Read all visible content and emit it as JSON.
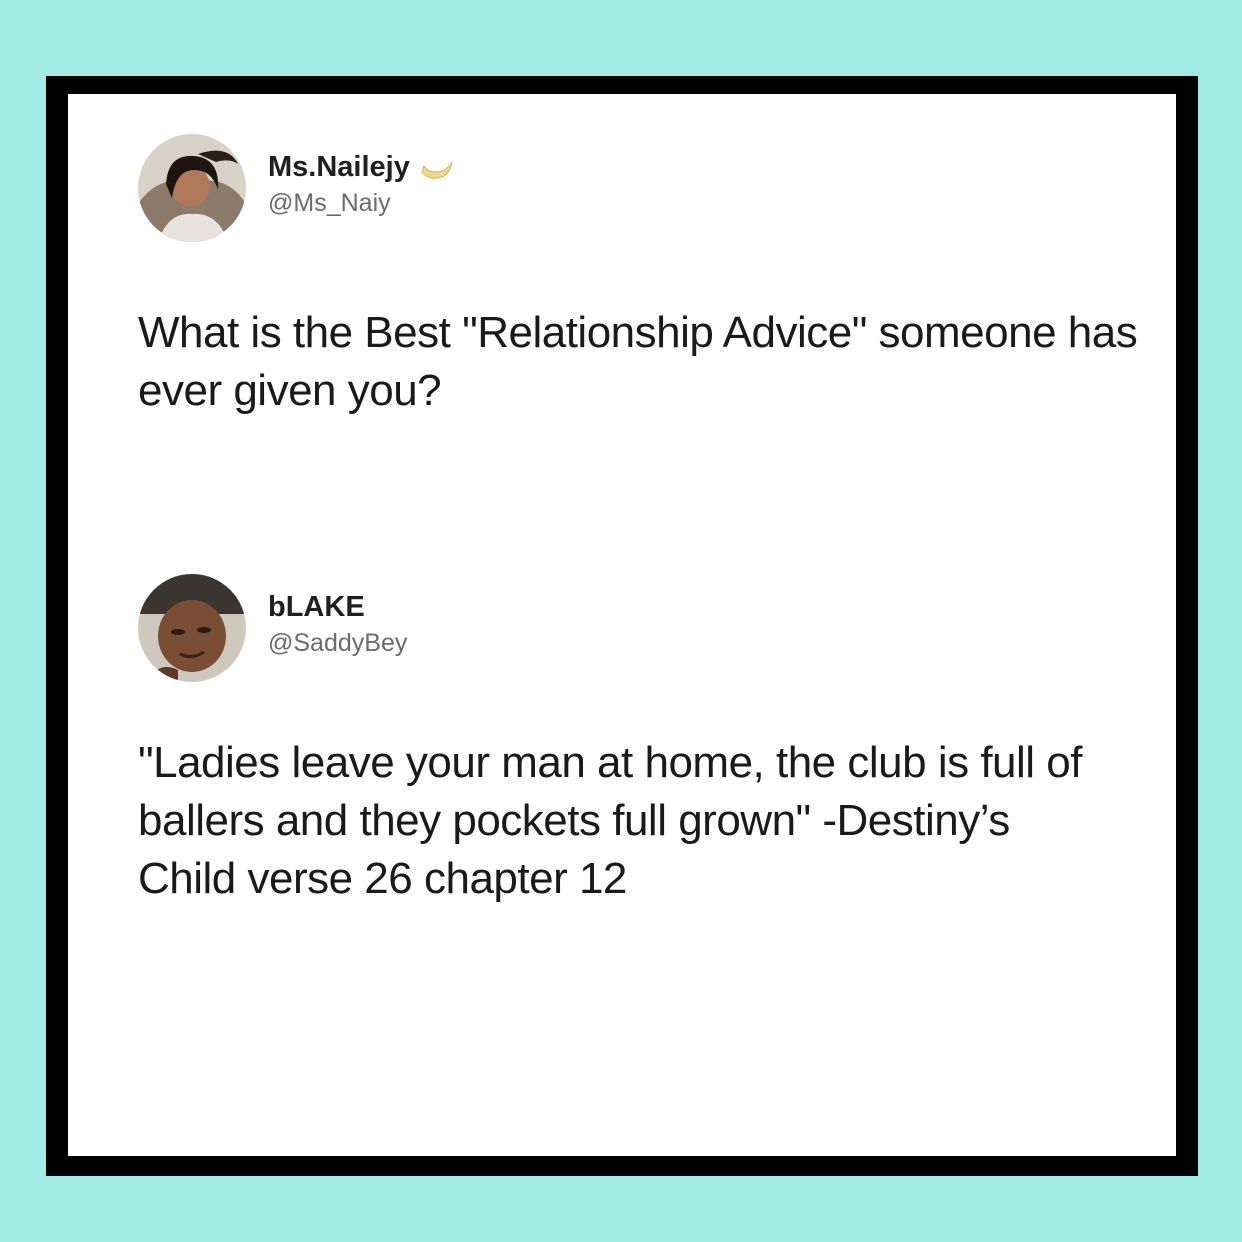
{
  "colors": {
    "background": "#a2ebe5",
    "frame": "#000000",
    "card": "#ffffff",
    "name_text": "#1f1f1f",
    "handle_text": "#6b6b6b",
    "body_text": "#1a1a1a"
  },
  "tweets": [
    {
      "display_name": "Ms.Nailejy",
      "handle": "@Ms_Naiy",
      "badge_icon": "crescent-moon-icon",
      "avatar_icon": "woman-avatar",
      "text": "What is the Best \"Relationship Advice\" someone has ever given you?"
    },
    {
      "display_name": "bLAKE",
      "handle": "@SaddyBey",
      "avatar_icon": "man-avatar",
      "text": "\"Ladies leave your man at home, the club is full of ballers and they pockets full grown\" -Destiny’s Child verse 26 chapter 12"
    }
  ]
}
